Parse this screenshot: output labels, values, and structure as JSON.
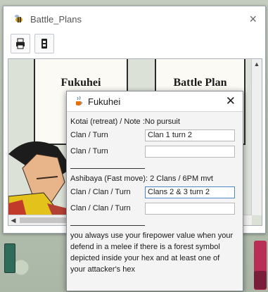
{
  "window": {
    "title": "Battle_Plans",
    "close_glyph": "×",
    "toolbar": [
      "print-icon",
      "device-icon"
    ]
  },
  "board": {
    "left_card_title": "Fukuhei",
    "right_card_title": "Battle Plan",
    "hscroll_left": "◀",
    "vscroll_up": "▲",
    "vscroll_down": "▼"
  },
  "dialog": {
    "title": "Fukuhei",
    "close_glyph": "✕",
    "kotai_line": "Kotai (retreat) / Note :No pursuit",
    "rows1": [
      {
        "label": "Clan / Turn",
        "value": "Clan 1 turn 2"
      },
      {
        "label": "Clan / Turn",
        "value": ""
      }
    ],
    "ashibaya_line": "Ashibaya (Fast move): 2 Clans / 6PM mvt",
    "rows2": [
      {
        "label": "Clan / Clan / Turn",
        "value": "Clans 2 & 3 turn 2"
      },
      {
        "label": "Clan / Clan / Turn",
        "value": ""
      }
    ],
    "note": "you always use your firepower value when your defend in a melee if there is a forest symbol depicted inside your hex and at least one of your attacker's hex"
  },
  "colors": {
    "accent_focus": "#4a86c8",
    "map_chip": "#b92e56",
    "map_token": "#2f6b5a"
  }
}
